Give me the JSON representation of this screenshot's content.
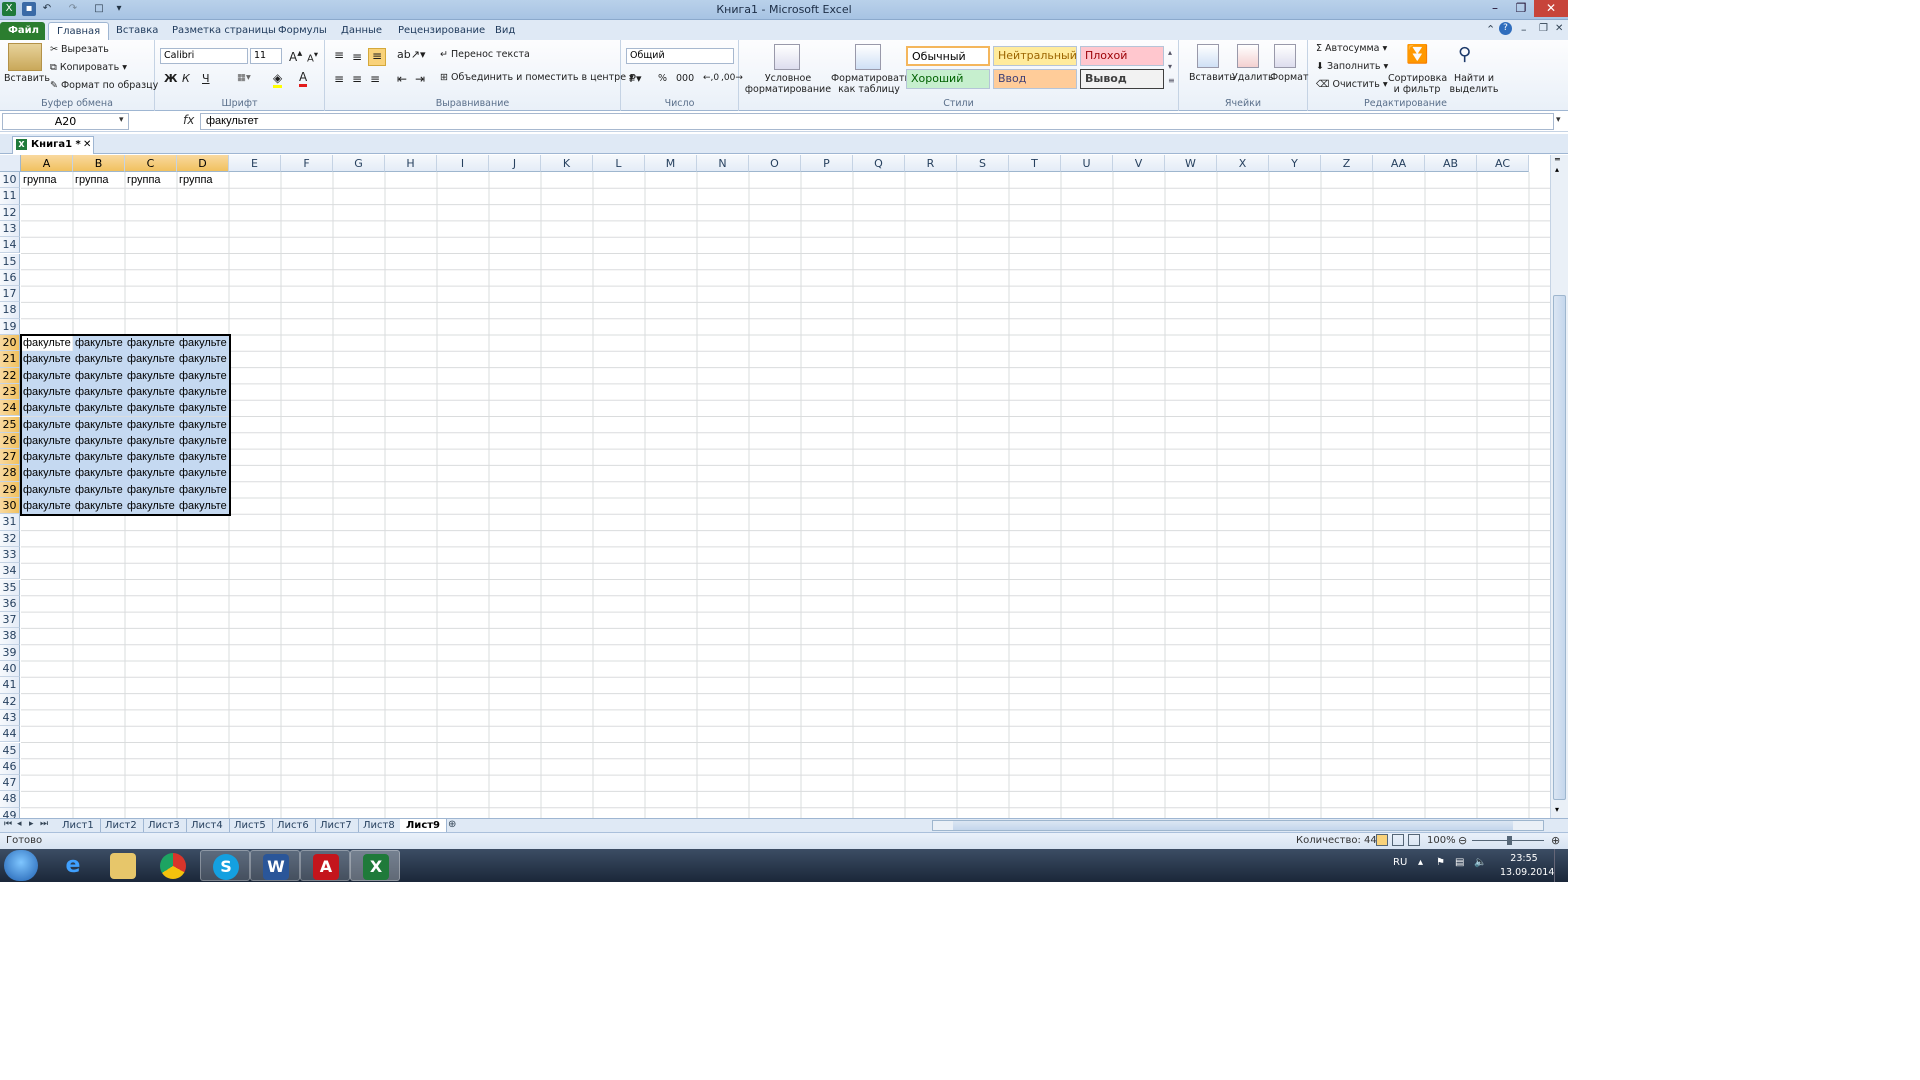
{
  "window": {
    "title": "Книга1  -  Microsoft Excel"
  },
  "ribbon_tabs": [
    "Файл",
    "Главная",
    "Вставка",
    "Разметка страницы",
    "Формулы",
    "Данные",
    "Рецензирование",
    "Вид"
  ],
  "clipboard": {
    "paste": "Вставить",
    "cut": "Вырезать",
    "copy": "Копировать",
    "format_painter": "Формат по образцу",
    "label": "Буфер обмена"
  },
  "font": {
    "name": "Calibri",
    "size": "11",
    "bold": "Ж",
    "italic": "К",
    "underline": "Ч",
    "label": "Шрифт"
  },
  "alignment": {
    "wrap": "Перенос текста",
    "merge": "Объединить и поместить в центре",
    "label": "Выравнивание"
  },
  "number": {
    "format": "Общий",
    "percent": "%",
    "thousands": "000",
    "label": "Число"
  },
  "styles": {
    "conditional": "Условное форматирование",
    "as_table": "Форматировать как таблицу",
    "normal": "Обычный",
    "neutral": "Нейтральный",
    "bad": "Плохой",
    "good": "Хороший",
    "input": "Ввод",
    "output": "Вывод",
    "label": "Стили"
  },
  "cells_group": {
    "insert": "Вставить",
    "delete": "Удалить",
    "format": "Формат",
    "label": "Ячейки"
  },
  "editing": {
    "autosum": "Автосумма",
    "fill": "Заполнить",
    "clear": "Очистить",
    "sort": "Сортировка и фильтр",
    "find": "Найти и выделить",
    "label": "Редактирование"
  },
  "formula_bar": {
    "name_box": "A20",
    "fx": "fx",
    "value": "факультет"
  },
  "workbook_tab": {
    "label": "Книга1  *"
  },
  "columns": [
    "A",
    "B",
    "C",
    "D",
    "E",
    "F",
    "G",
    "H",
    "I",
    "J",
    "K",
    "L",
    "M",
    "N",
    "O",
    "P",
    "Q",
    "R",
    "S",
    "T",
    "U",
    "V",
    "W",
    "X",
    "Y",
    "Z",
    "AA",
    "AB",
    "AC"
  ],
  "rows": [
    "10",
    "11",
    "12",
    "13",
    "14",
    "15",
    "16",
    "17",
    "18",
    "19",
    "20",
    "21",
    "22",
    "23",
    "24",
    "25",
    "26",
    "27",
    "28",
    "29",
    "30",
    "31",
    "32",
    "33",
    "34",
    "35",
    "36",
    "37",
    "38",
    "39",
    "40",
    "41",
    "42",
    "43",
    "44",
    "45",
    "46",
    "47",
    "48",
    "49"
  ],
  "row10_values": [
    "группа",
    "группа",
    "группа",
    "группа"
  ],
  "block_value": "факульте",
  "sheets": [
    "Лист1",
    "Лист2",
    "Лист3",
    "Лист4",
    "Лист5",
    "Лист6",
    "Лист7",
    "Лист8",
    "Лист9"
  ],
  "active_sheet": "Лист9",
  "status": {
    "ready": "Готово",
    "count": "Количество: 44",
    "zoom": "100%"
  },
  "taskbar": {
    "lang": "RU",
    "time": "23:55",
    "date": "13.09.2014"
  }
}
